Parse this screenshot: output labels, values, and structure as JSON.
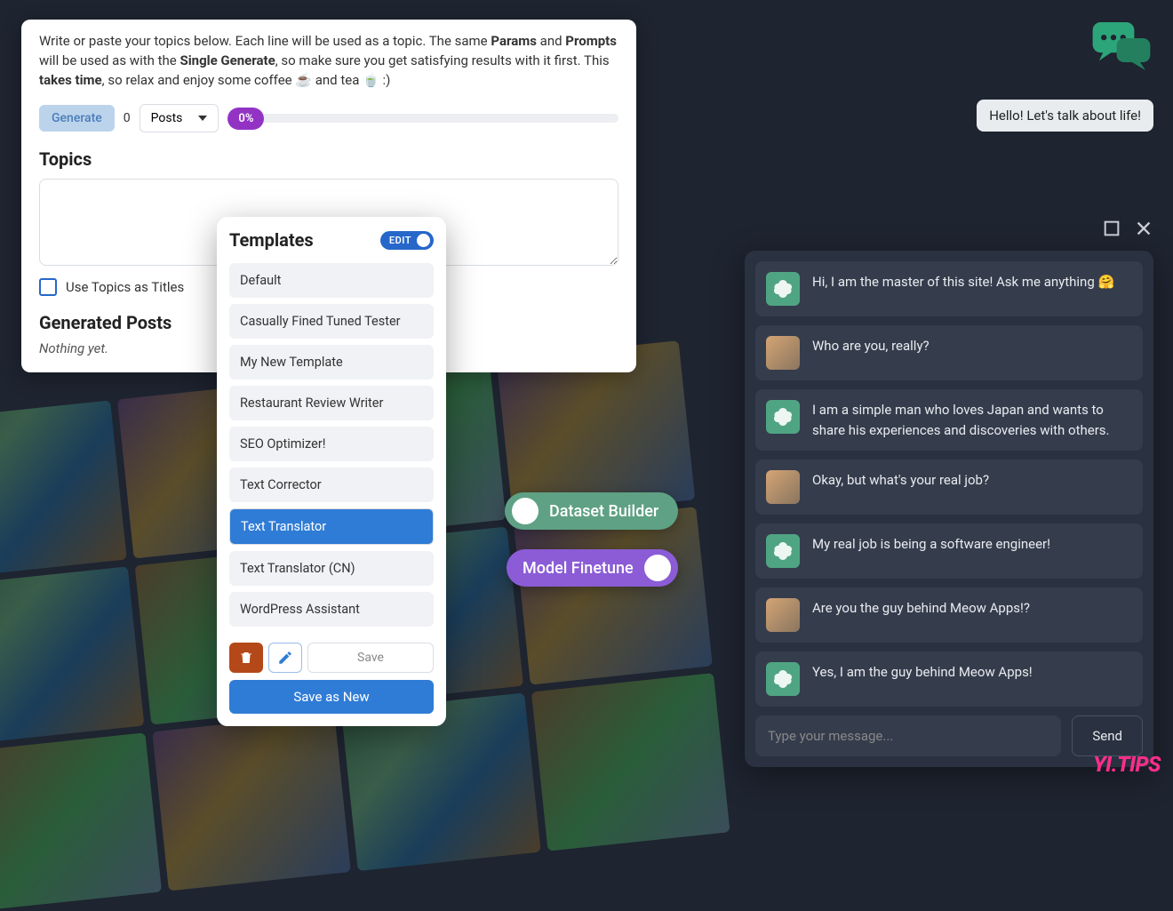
{
  "bulk": {
    "desc_1": "Write or paste your topics below. Each line will be used as a topic. The same ",
    "desc_b1": "Params",
    "desc_2": " and ",
    "desc_b2": "Prompts",
    "desc_3": " will be used as with the ",
    "desc_b3": "Single Generate",
    "desc_4": ", so make sure you get satisfying results with it first. This ",
    "desc_b4": "takes time",
    "desc_5": ", so relax and enjoy some coffee ☕ and tea 🍵 :)",
    "generate_label": "Generate",
    "count": "0",
    "select_value": "Posts",
    "progress": "0%",
    "topics_heading": "Topics",
    "use_titles_label": "Use Topics as Titles",
    "generated_heading": "Generated Posts",
    "nothing_label": "Nothing yet."
  },
  "templates": {
    "heading": "Templates",
    "edit_label": "EDIT",
    "items": [
      {
        "label": "Default",
        "selected": false
      },
      {
        "label": "Casually Fined Tuned Tester",
        "selected": false
      },
      {
        "label": "My New Template",
        "selected": false
      },
      {
        "label": "Restaurant Review Writer",
        "selected": false
      },
      {
        "label": "SEO Optimizer!",
        "selected": false
      },
      {
        "label": "Text Corrector",
        "selected": false
      },
      {
        "label": "Text Translator",
        "selected": true
      },
      {
        "label": "Text Translator (CN)",
        "selected": false
      },
      {
        "label": "WordPress Assistant",
        "selected": false
      }
    ],
    "save_label": "Save",
    "save_new_label": "Save as New"
  },
  "pills": {
    "dataset": "Dataset Builder",
    "finetune": "Model Finetune"
  },
  "greeting": "Hello! Let's talk about life!",
  "chat": {
    "messages": [
      {
        "role": "ai",
        "text": "Hi, I am the master of this site! Ask me anything 🤗"
      },
      {
        "role": "user",
        "text": "Who are you, really?"
      },
      {
        "role": "ai",
        "text": "I am a simple man who loves Japan and wants to share his experiences and discoveries with others."
      },
      {
        "role": "user",
        "text": "Okay, but what's your real job?"
      },
      {
        "role": "ai",
        "text": "My real job is being a software engineer!"
      },
      {
        "role": "user",
        "text": "Are you the guy behind Meow Apps!?"
      },
      {
        "role": "ai",
        "text": "Yes, I am the guy behind Meow Apps!"
      }
    ],
    "placeholder": "Type your message...",
    "send_label": "Send"
  },
  "watermark": "YI.TIPS"
}
